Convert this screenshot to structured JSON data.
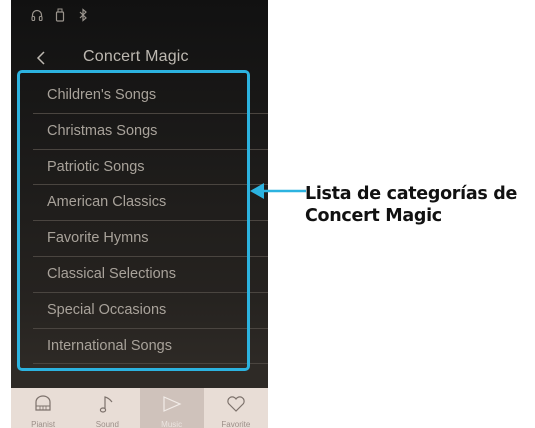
{
  "status_icons": [
    "headphones-icon",
    "usb-icon",
    "bluetooth-icon"
  ],
  "header": {
    "title": "Concert Magic",
    "back_icon": "chevron-left-icon"
  },
  "categories": [
    "Children's Songs",
    "Christmas Songs",
    "Patriotic Songs",
    "American Classics",
    "Favorite Hymns",
    "Classical Selections",
    "Special Occasions",
    "International Songs"
  ],
  "tabs": [
    {
      "label": "Pianist",
      "icon": "piano-icon",
      "active": false
    },
    {
      "label": "Sound",
      "icon": "music-note-icon",
      "active": false
    },
    {
      "label": "Music",
      "icon": "play-icon",
      "active": true
    },
    {
      "label": "Favorite",
      "icon": "heart-icon",
      "active": false
    }
  ],
  "annotation": {
    "line1": "Lista de categorías de",
    "line2": "Concert Magic",
    "color": "#2cb3e0"
  }
}
